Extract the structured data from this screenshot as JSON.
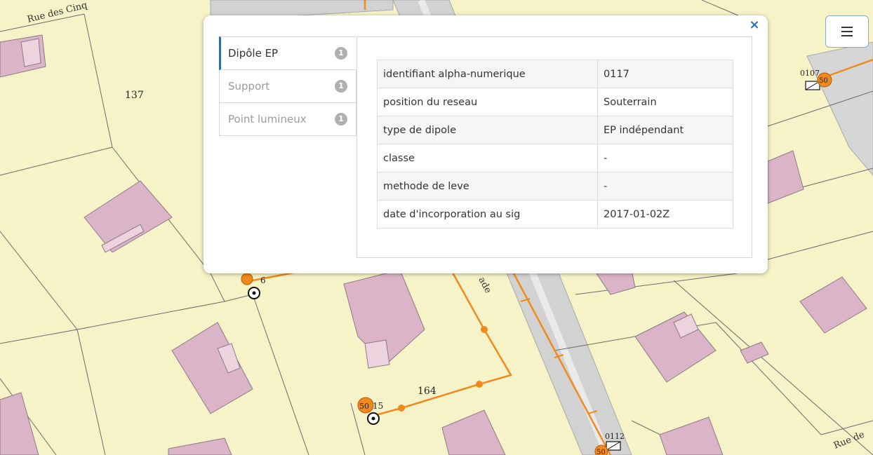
{
  "map": {
    "street_labels": [
      "Rue des Cinq",
      "Rue de",
      "ade"
    ],
    "parcel_numbers": [
      "137",
      "164"
    ],
    "point_labels": [
      "0107",
      "0112",
      "6",
      "5015"
    ],
    "marker_values": [
      "50",
      "50",
      "50"
    ],
    "colors": {
      "parcel": "#f7f3c8",
      "building": "#dcb4c8",
      "road": "#d2d2d2",
      "network": "#f08a1e"
    }
  },
  "popup": {
    "close_label": "×",
    "tabs": [
      {
        "label": "Dipôle EP",
        "count": "1"
      },
      {
        "label": "Support",
        "count": "1"
      },
      {
        "label": "Point lumineux",
        "count": "1"
      }
    ],
    "rows": [
      {
        "key": "identifiant alpha-numerique",
        "value": "0117"
      },
      {
        "key": "position du reseau",
        "value": "Souterrain"
      },
      {
        "key": "type de dipole",
        "value": "EP indépendant"
      },
      {
        "key": "classe",
        "value": "-"
      },
      {
        "key": "methode de leve",
        "value": "-"
      },
      {
        "key": "date d'incorporation au sig",
        "value": "2017-01-02Z"
      }
    ]
  },
  "menu": {
    "icon": "hamburger-menu-icon"
  }
}
